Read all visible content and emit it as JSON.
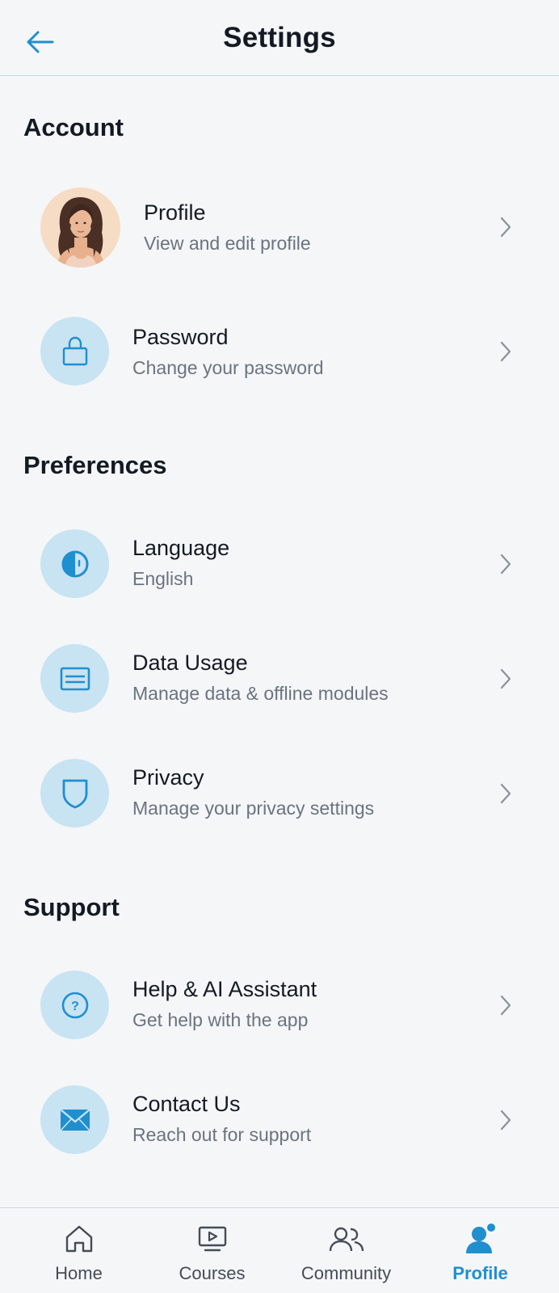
{
  "header": {
    "title": "Settings",
    "back_icon": "arrow-left-icon"
  },
  "sections": {
    "account": {
      "title": "Account",
      "profile": {
        "title": "Profile",
        "subtitle": "View and edit profile"
      },
      "password": {
        "title": "Password",
        "subtitle": "Change your password",
        "icon": "lock-icon"
      }
    },
    "preferences": {
      "title": "Preferences",
      "language": {
        "title": "Language",
        "subtitle": "English",
        "icon": "contrast-icon"
      },
      "data_usage": {
        "title": "Data Usage",
        "subtitle": "Manage data & offline modules",
        "icon": "storage-icon"
      },
      "privacy": {
        "title": "Privacy",
        "subtitle": "Manage your privacy settings",
        "icon": "shield-icon"
      }
    },
    "support": {
      "title": "Support",
      "help": {
        "title": "Help & AI Assistant",
        "subtitle": "Get help with the app",
        "icon": "help-circle-icon"
      },
      "contact": {
        "title": "Contact Us",
        "subtitle": "Reach out for support",
        "icon": "mail-icon"
      }
    }
  },
  "bottom_nav": {
    "home": {
      "label": "Home",
      "icon": "home-icon"
    },
    "courses": {
      "label": "Courses",
      "icon": "play-screen-icon"
    },
    "community": {
      "label": "Community",
      "icon": "users-icon"
    },
    "profile": {
      "label": "Profile",
      "icon": "person-icon",
      "active": true
    }
  },
  "colors": {
    "accent": "#1f8fcf",
    "icon_bg": "#c8e3f2",
    "background": "#f5f6f8",
    "text": "#141a24",
    "subtext": "#6b7381"
  }
}
